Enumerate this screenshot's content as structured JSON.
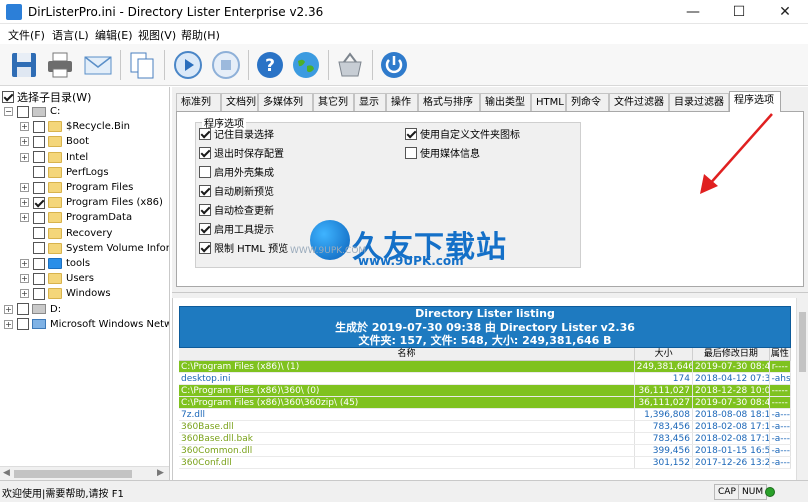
{
  "window": {
    "title": "DirListerPro.ini - Directory Lister Enterprise v2.36",
    "minimize": "—",
    "maximize": "☐",
    "close": "✕"
  },
  "menu": [
    "文件(F)",
    "语言(L)",
    "编辑(E)",
    "视图(V)",
    "帮助(H)"
  ],
  "toolbar": [
    "save-icon",
    "print-icon",
    "email-icon",
    "copy-icon",
    "play-icon",
    "stop-icon",
    "help-icon",
    "web-icon",
    "basket-icon",
    "power-icon"
  ],
  "sidebar": {
    "select_subdirs": "选择子目录(W)",
    "tree": [
      {
        "label": "C:",
        "type": "drive",
        "expand": "−",
        "checked": false,
        "level": 0
      },
      {
        "label": "$Recycle.Bin",
        "type": "folder",
        "expand": "+",
        "checked": false,
        "level": 1
      },
      {
        "label": "Boot",
        "type": "folder",
        "expand": "+",
        "checked": false,
        "level": 1
      },
      {
        "label": "Intel",
        "type": "folder",
        "expand": "+",
        "checked": false,
        "level": 1
      },
      {
        "label": "PerfLogs",
        "type": "folder",
        "expand": "",
        "checked": false,
        "level": 1
      },
      {
        "label": "Program Files",
        "type": "folder",
        "expand": "+",
        "checked": false,
        "level": 1
      },
      {
        "label": "Program Files (x86)",
        "type": "folder",
        "expand": "+",
        "checked": true,
        "level": 1
      },
      {
        "label": "ProgramData",
        "type": "folder",
        "expand": "+",
        "checked": false,
        "level": 1
      },
      {
        "label": "Recovery",
        "type": "folder",
        "expand": "",
        "checked": false,
        "level": 1
      },
      {
        "label": "System Volume Informatic",
        "type": "folder",
        "expand": "",
        "checked": false,
        "level": 1
      },
      {
        "label": "tools",
        "type": "folder-blue",
        "expand": "+",
        "checked": false,
        "level": 1
      },
      {
        "label": "Users",
        "type": "folder",
        "expand": "+",
        "checked": false,
        "level": 1
      },
      {
        "label": "Windows",
        "type": "folder",
        "expand": "+",
        "checked": false,
        "level": 1
      },
      {
        "label": "D:",
        "type": "drive",
        "expand": "+",
        "checked": false,
        "level": 0
      },
      {
        "label": "Microsoft Windows Network",
        "type": "network",
        "expand": "+",
        "checked": false,
        "level": 0
      }
    ]
  },
  "tabs": [
    "标准列",
    "文档列",
    "多媒体列",
    "其它列",
    "显示",
    "操作",
    "格式与排序",
    "输出类型",
    "HTML",
    "列命令",
    "文件过滤器",
    "目录过滤器",
    "程序选项"
  ],
  "active_tab": 12,
  "options": {
    "group_title": "程序选项",
    "left": [
      {
        "label": "记住目录选择",
        "checked": true
      },
      {
        "label": "退出时保存配置",
        "checked": true
      },
      {
        "label": "启用外壳集成",
        "checked": false
      },
      {
        "label": "自动刷新预览",
        "checked": true
      },
      {
        "label": "自动检查更新",
        "checked": true
      },
      {
        "label": "启用工具提示",
        "checked": true
      },
      {
        "label": "限制 HTML 预览",
        "checked": true
      }
    ],
    "right": [
      {
        "label": "使用自定义文件夹图标",
        "checked": true
      },
      {
        "label": "使用媒体信息",
        "checked": false
      }
    ]
  },
  "watermark": {
    "text": "久友下载站",
    "url": "www.9UPK.com",
    "url2": "WWW.9UPK.COM"
  },
  "report": {
    "title": "Directory Lister listing",
    "subtitle": "生成於 2019-07-30 09:38 由 Directory Lister v2.36",
    "summary": "文件夹: 157, 文件: 548, 大小: 249,381,646 B",
    "columns": [
      "名称",
      "大小",
      "最后修改日期",
      "属性"
    ],
    "rows": [
      {
        "kind": "dir",
        "name": "C:\\Program Files (x86)\\ (1)",
        "size": "249,381,646",
        "date": "2019-07-30 08:47",
        "attr": "r----"
      },
      {
        "kind": "file",
        "name": "desktop.ini",
        "size": "174",
        "date": "2018-04-12 07:36",
        "attr": "-ahs-"
      },
      {
        "kind": "dir",
        "name": "C:\\Program Files (x86)\\360\\ (0)",
        "size": "36,111,027",
        "date": "2018-12-28 10:05",
        "attr": "-----"
      },
      {
        "kind": "dir",
        "name": "C:\\Program Files (x86)\\360\\360zip\\ (45)",
        "size": "36,111,027",
        "date": "2019-07-30 08:47",
        "attr": "-----"
      },
      {
        "kind": "file",
        "name": "7z.dll",
        "size": "1,396,808",
        "date": "2018-08-08 18:17",
        "attr": "-a---"
      },
      {
        "kind": "file",
        "name": "360Base.dll",
        "size": "783,456",
        "date": "2018-02-08 17:15",
        "attr": "-a---"
      },
      {
        "kind": "file",
        "name": "360Base.dll.bak",
        "size": "783,456",
        "date": "2018-02-08 17:15",
        "attr": "-a---"
      },
      {
        "kind": "file",
        "name": "360Common.dll",
        "size": "399,456",
        "date": "2018-01-15 16:54",
        "attr": "-a---"
      },
      {
        "kind": "file",
        "name": "360Conf.dll",
        "size": "301,152",
        "date": "2017-12-26 13:26",
        "attr": "-a---"
      }
    ]
  },
  "status": {
    "text": "欢迎使用|需要帮助,请按 F1",
    "cap": "CAP",
    "num": "NUM"
  },
  "colors": {
    "report_header": "#1e7ac0",
    "dir_row": "#7fc21f",
    "file_text": "#1a66b8",
    "arrow": "#e02020"
  }
}
